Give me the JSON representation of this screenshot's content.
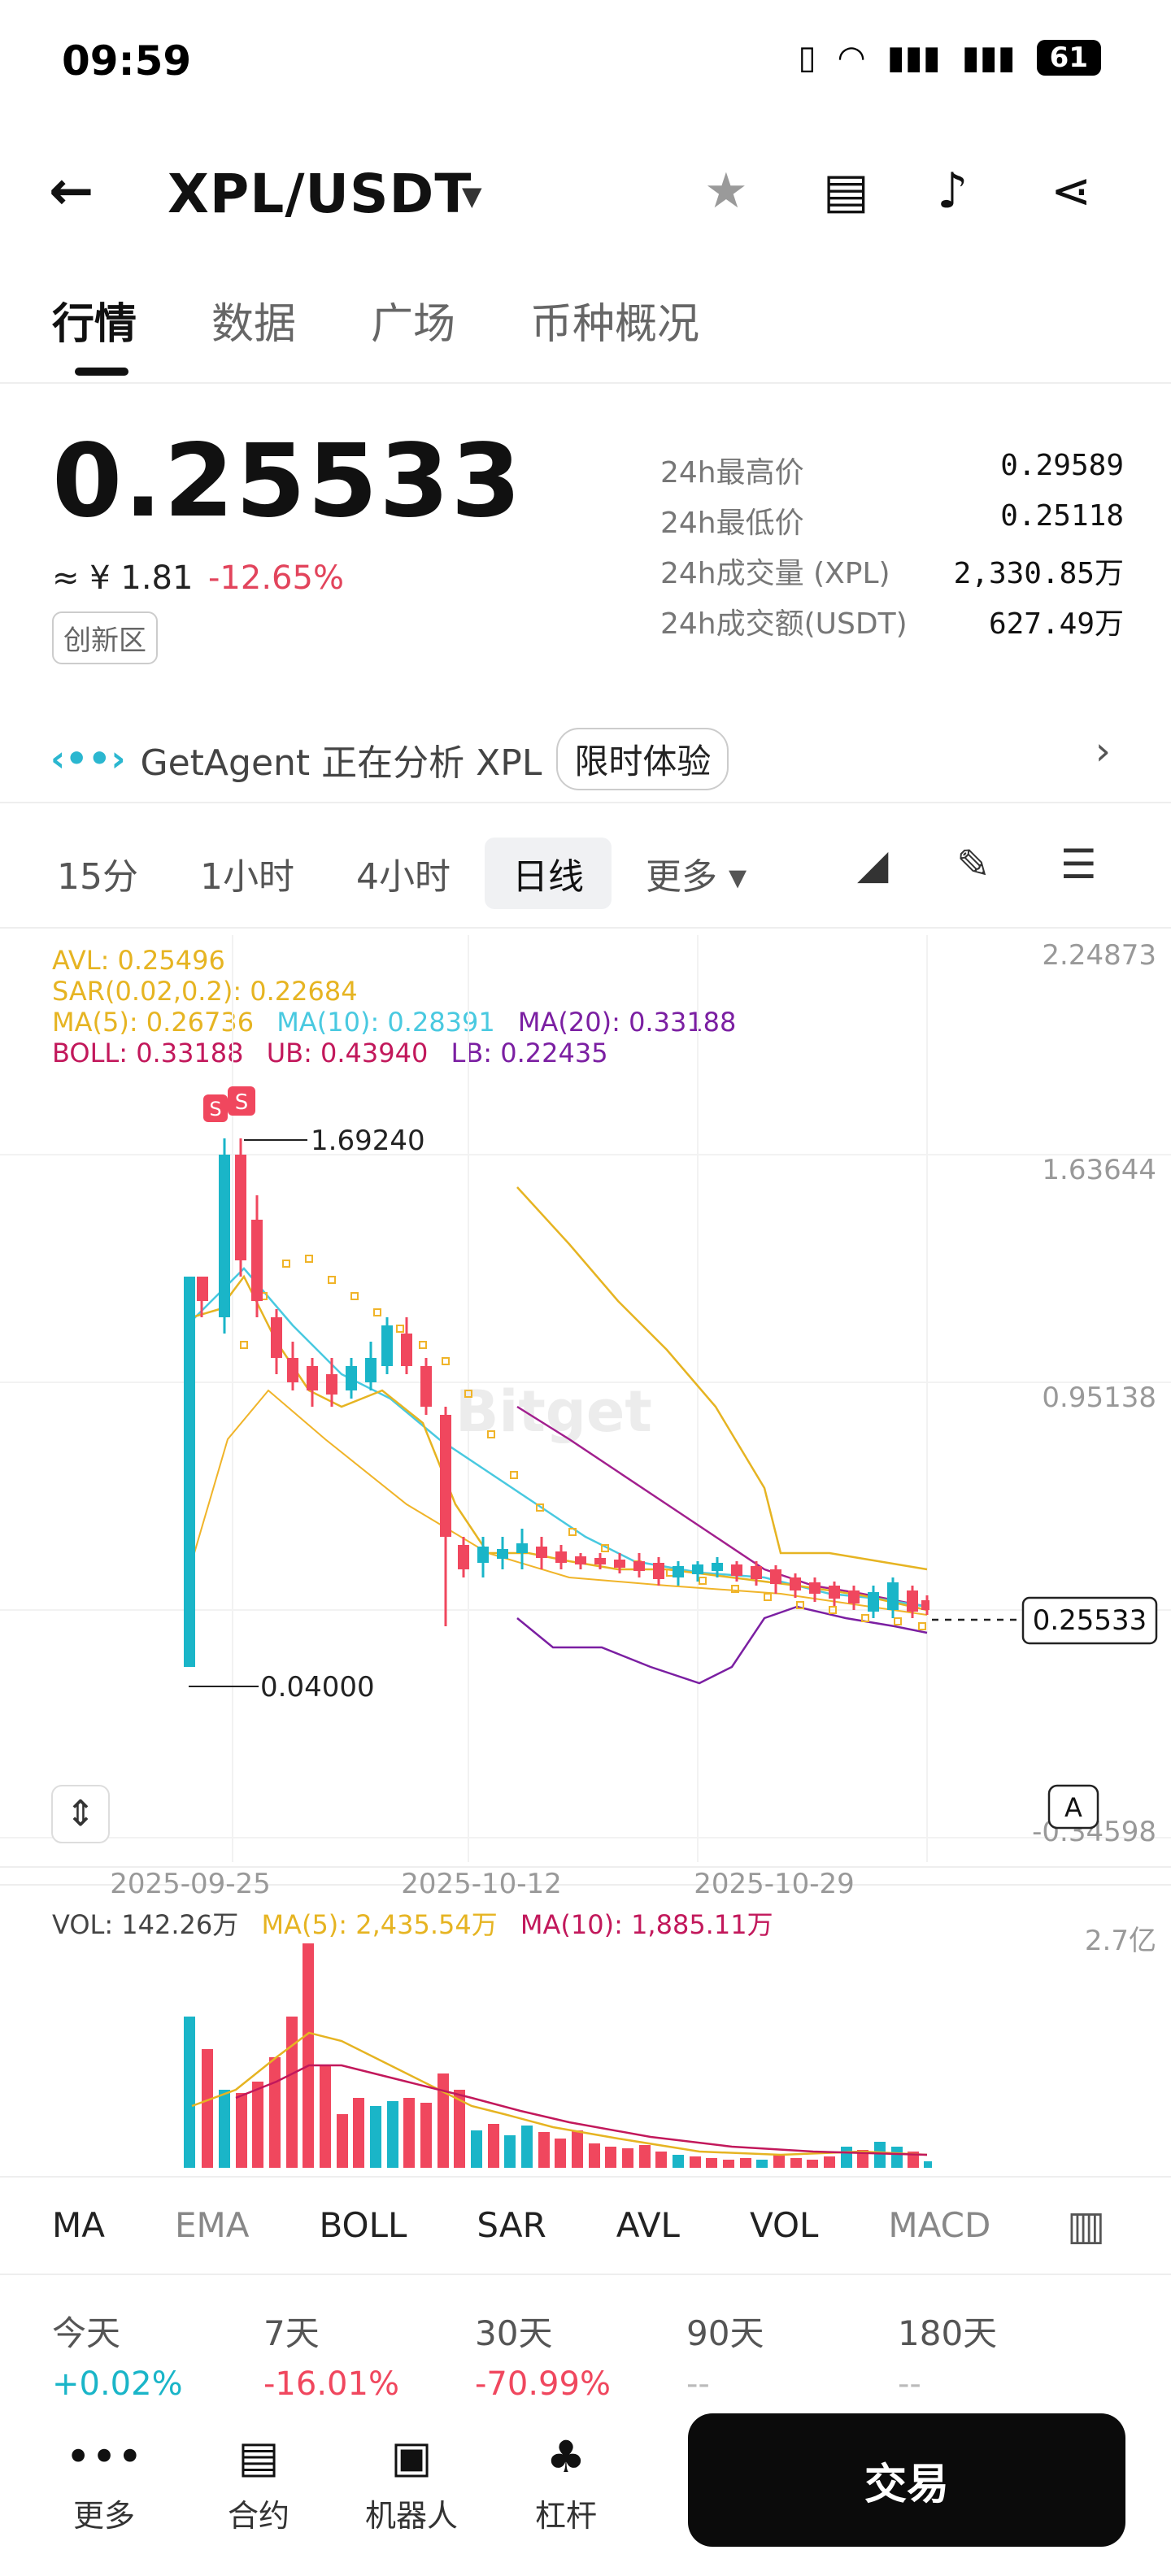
{
  "status": {
    "time": "09:59",
    "battery": "61"
  },
  "header": {
    "pair": "XPL/USDT"
  },
  "tabs": [
    {
      "label": "行情"
    },
    {
      "label": "数据"
    },
    {
      "label": "广场"
    },
    {
      "label": "币种概况"
    }
  ],
  "price": {
    "last": "0.25533",
    "cny": "≈ ¥ 1.81",
    "change": "-12.65%",
    "zone": "创新区"
  },
  "stats": [
    {
      "label": "24h最高价",
      "value": "0.29589"
    },
    {
      "label": "24h最低价",
      "value": "0.25118"
    },
    {
      "label": "24h成交量 (XPL)",
      "value": "2,330.85万"
    },
    {
      "label": "24h成交额(USDT)",
      "value": "627.49万"
    }
  ],
  "agent": {
    "logo": "‹••›",
    "text": "GetAgent 正在分析 XPL",
    "pill": "限时体验"
  },
  "intervals": [
    {
      "label": "15分"
    },
    {
      "label": "1小时"
    },
    {
      "label": "4小时"
    },
    {
      "label": "日线"
    },
    {
      "label": "更多 ▾"
    }
  ],
  "indicators": {
    "avl": "AVL: 0.25496",
    "sar": "SAR(0.02,0.2): 0.22684",
    "ma5": "MA(5): 0.26736",
    "ma10": "MA(10): 0.28391",
    "ma20": "MA(20): 0.33188",
    "boll": "BOLL: 0.33188",
    "ub": "UB: 0.43940",
    "lb": "LB: 0.22435"
  },
  "vol_indicators": {
    "vol": "VOL: 142.26万",
    "ma5": "MA(5): 2,435.54万",
    "ma10": "MA(10): 1,885.11万"
  },
  "chart_labels": {
    "y_axis": [
      "2.24873",
      "1.63644",
      "0.95138",
      "-0.34598"
    ],
    "x_axis": [
      "2025-09-25",
      "2025-10-12",
      "2025-10-29"
    ],
    "high_mark": "1.69240",
    "low_mark": "0.04000",
    "current": "0.25533",
    "vol_axis": "2.7亿",
    "auto_btn": "A",
    "sell_marker": "S",
    "watermark": "Bitget"
  },
  "indicator_tabs": [
    {
      "label": "MA"
    },
    {
      "label": "EMA"
    },
    {
      "label": "BOLL"
    },
    {
      "label": "SAR"
    },
    {
      "label": "AVL"
    },
    {
      "label": "VOL"
    },
    {
      "label": "MACD"
    }
  ],
  "performance": [
    {
      "label": "今天",
      "value": "+0.02%"
    },
    {
      "label": "7天",
      "value": "-16.01%"
    },
    {
      "label": "30天",
      "value": "-70.99%"
    },
    {
      "label": "90天",
      "value": "--"
    },
    {
      "label": "180天",
      "value": "--"
    }
  ],
  "bottom_nav": [
    {
      "label": "更多",
      "icon": "more-icon"
    },
    {
      "label": "合约",
      "icon": "contract-icon"
    },
    {
      "label": "机器人",
      "icon": "robot-icon"
    },
    {
      "label": "杠杆",
      "icon": "margin-icon"
    }
  ],
  "trade_button": "交易",
  "colors": {
    "up": "#1ab5c8",
    "down": "#f0475e",
    "avl": "#e6b422",
    "ma10": "#49c9e0",
    "ma20": "#7b1fa2",
    "boll": "#c2185b",
    "sar": "#f0b429"
  },
  "chart_data": {
    "type": "candlestick",
    "x": [
      "2025-09-25",
      "2025-10-12",
      "2025-10-29"
    ],
    "y_ticks": [
      2.24873,
      1.63644,
      0.95138,
      -0.34598
    ],
    "high": 1.6924,
    "low": 0.04,
    "last": 0.25533
  }
}
